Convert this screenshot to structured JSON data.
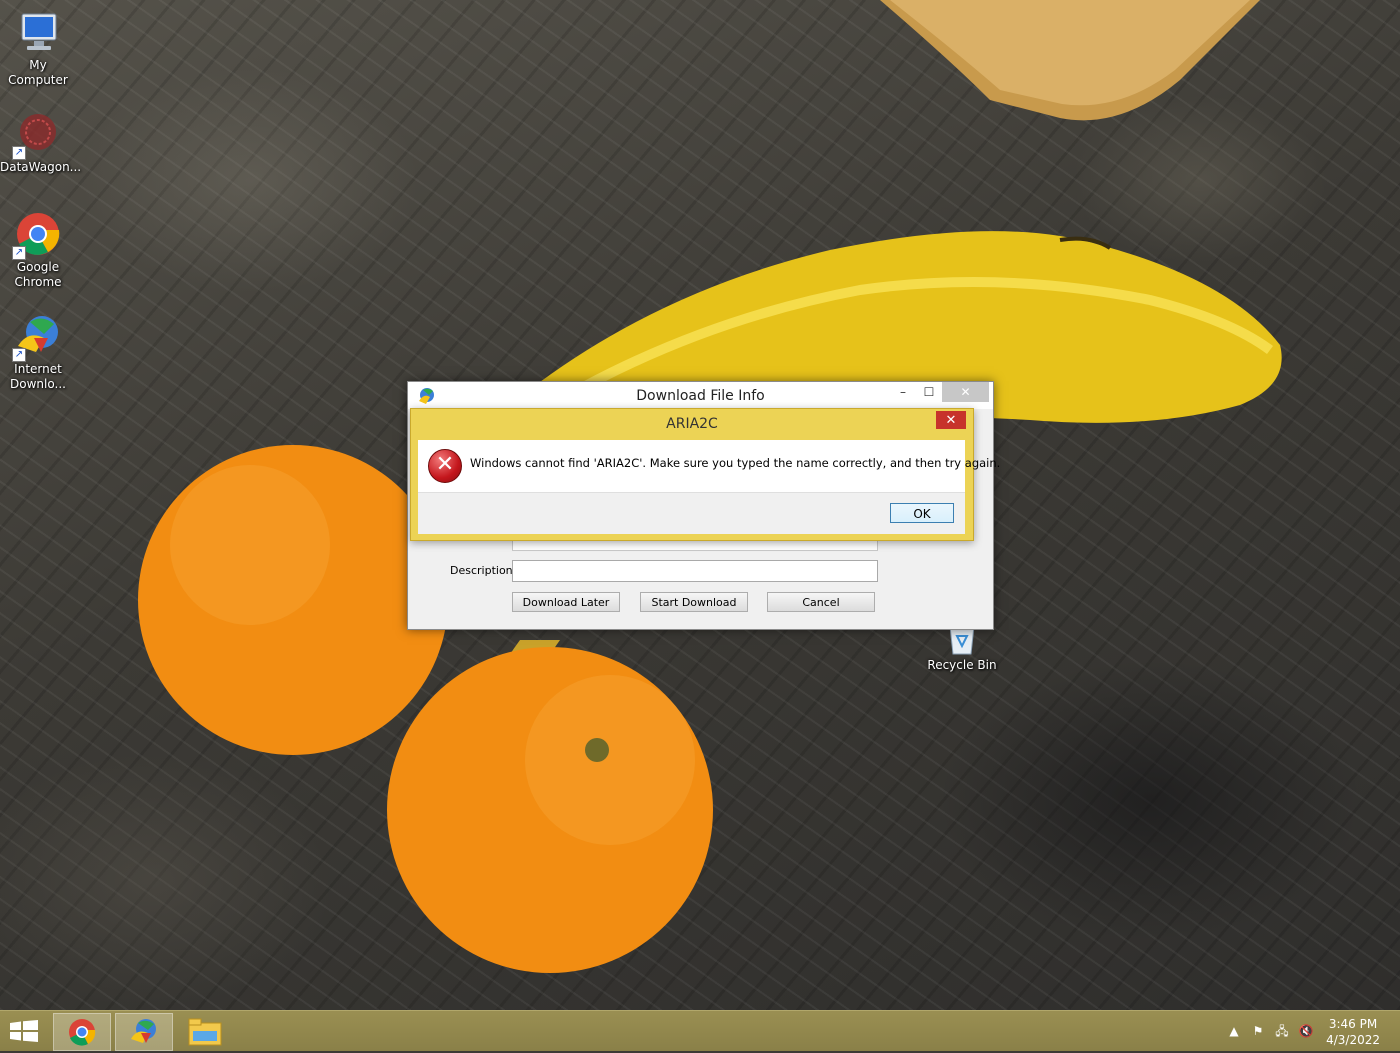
{
  "desktop": {
    "icons": [
      {
        "label": "My Computer",
        "icon": "my-computer-icon"
      },
      {
        "label": "DataWagon...",
        "icon": "datawagon-icon"
      },
      {
        "label": "Google Chrome",
        "icon": "chrome-icon"
      },
      {
        "label": "Internet Downlo...",
        "icon": "idm-icon"
      },
      {
        "label": "Recycle Bin",
        "icon": "recycle-bin-icon"
      }
    ]
  },
  "download_window": {
    "title": "Download File Info",
    "minimize": "–",
    "maximize": "☐",
    "close": "✕",
    "description_label": "Description",
    "description_value": "",
    "buttons": {
      "download_later": "Download Later",
      "start_download": "Start Download",
      "cancel": "Cancel"
    }
  },
  "error_dialog": {
    "title": "ARIA2C",
    "close": "✕",
    "message": "Windows cannot find 'ARIA2C'. Make sure you typed the name correctly, and then try again.",
    "ok": "OK"
  },
  "taskbar": {
    "pinned": [
      "chrome-icon",
      "idm-icon",
      "file-explorer-icon"
    ],
    "clock_time": "3:46 PM",
    "clock_date": "4/3/2022"
  },
  "colors": {
    "taskbar": "#8a8048",
    "dialog_frame": "#ecd355",
    "close_red": "#c7332b"
  }
}
